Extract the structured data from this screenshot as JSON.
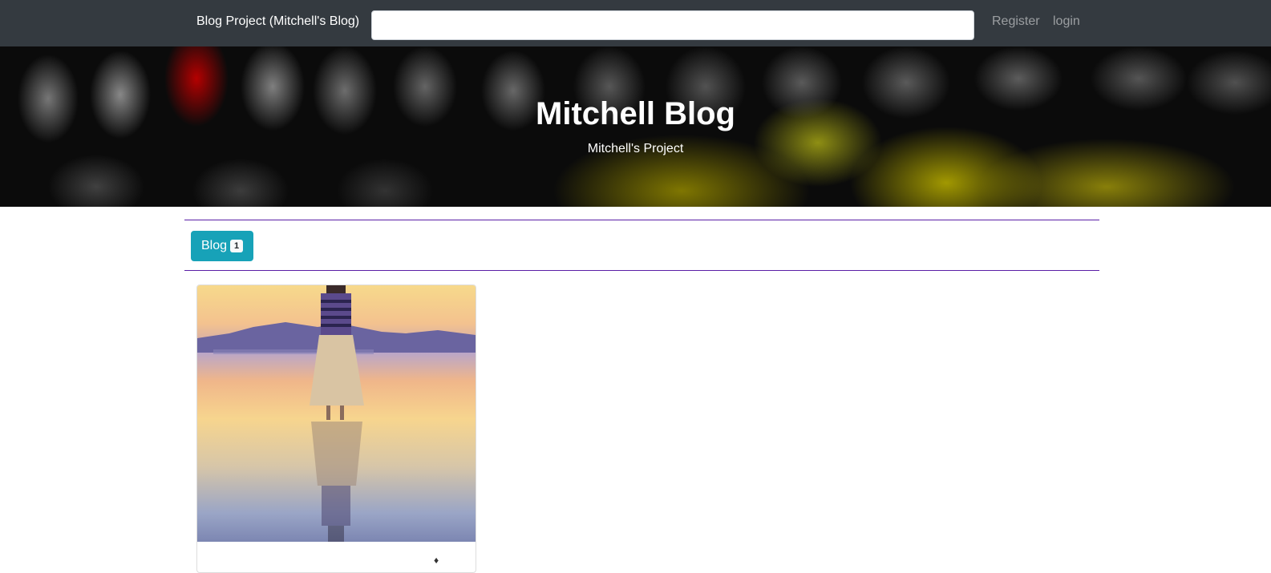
{
  "navbar": {
    "brand": "Blog Project (Mitchell's Blog)",
    "search_value": "",
    "search_placeholder": "",
    "links": {
      "register": "Register",
      "login": "login"
    }
  },
  "hero": {
    "title": "Mitchell Blog",
    "subtitle": "Mitchell's Project"
  },
  "categories": [
    {
      "label": "Blog",
      "count": "1"
    }
  ],
  "posts": [
    {
      "image": "woman-standing-on-wet-beach-at-sunset"
    }
  ],
  "colors": {
    "navbar_bg": "#343a40",
    "accent_rule": "#5a1ea6",
    "category_button": "#17a2b8"
  }
}
